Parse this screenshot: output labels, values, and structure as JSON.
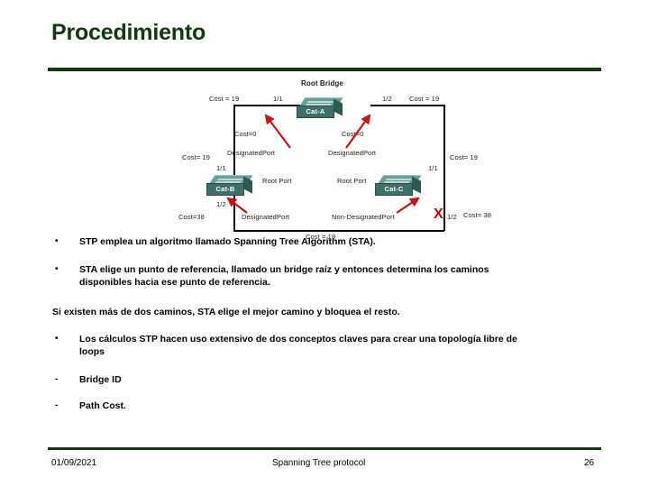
{
  "slide": {
    "title": "Procedimiento",
    "accent_color": "#14380f"
  },
  "diagram": {
    "root_bridge_label": "Root Bridge",
    "switches": [
      {
        "name": "Cat-A",
        "role": "root-bridge"
      },
      {
        "name": "Cat-B",
        "role": "designated"
      },
      {
        "name": "Cat-C",
        "role": "non-designated"
      }
    ],
    "labels": {
      "cost_top_left": "Cost = 19",
      "cost_top_right": "Cost = 19",
      "port_a_left": "1/1",
      "port_a_right": "1/2",
      "cost_zero_left": "Cost=0",
      "cost_zero_right": "Cost=0",
      "designated_port_top_left": "DesignatedPort",
      "designated_port_top_right": "DesignatedPort",
      "cost_mid_left": "Cost= 19",
      "cost_mid_right": "Cost= 19",
      "port_b_top": "1/1",
      "port_c_top": "1/1",
      "root_port_left": "Root Port",
      "root_port_right": "Root Port",
      "port_b_bottom": "1/2",
      "port_c_bottom": "1/2",
      "cost_bottom_left": "Cost=38",
      "cost_bottom_right": "Cost= 38",
      "designated_port_bottom": "DesignatedPort",
      "non_designated_port_bottom": "Non-DesignatedPort",
      "cost_bottom_center": "Cost = 19",
      "blocked_marker": "X"
    }
  },
  "content": {
    "bullet_marker": "•",
    "dash_marker": "-",
    "items": [
      {
        "marker": "bullet",
        "text": "STP emplea un algoritmo llamado Spanning Tree Algorithm (STA)."
      },
      {
        "marker": "bullet",
        "text_line1": "STA elige un punto de referencia, llamado un bridge raíz y entonces determina los caminos",
        "text_line2": "disponibles hacia ese punto de referencia."
      },
      {
        "marker": "none",
        "text": "Si existen más de dos caminos, STA elige el mejor camino y bloquea el resto."
      },
      {
        "marker": "bullet",
        "text_line1": "Los cálculos STP hacen uso extensivo de dos conceptos claves para crear una topología libre de",
        "text_line2": "loops"
      },
      {
        "marker": "dash",
        "text": "Bridge ID"
      },
      {
        "marker": "dash",
        "text": "Path Cost."
      }
    ]
  },
  "footer": {
    "date": "01/09/2021",
    "title": "Spanning Tree protocol",
    "page_number": "26"
  }
}
